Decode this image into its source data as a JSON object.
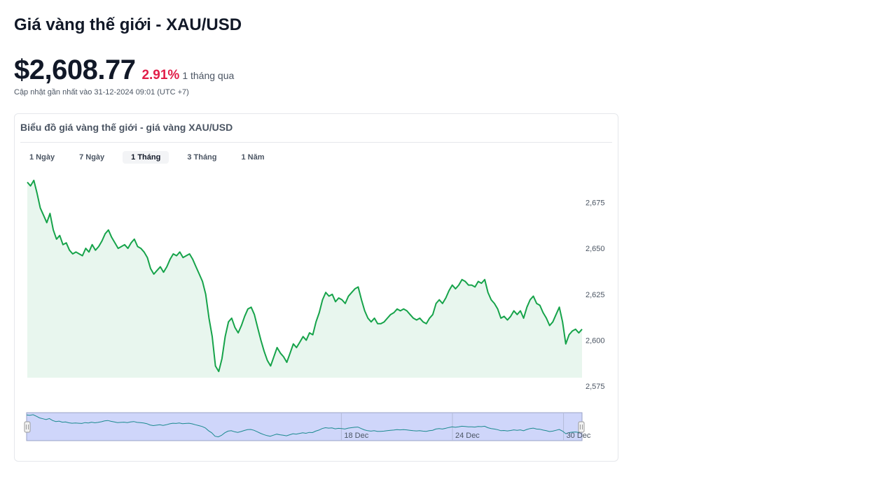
{
  "header": {
    "title": "Giá vàng thế giới - XAU/USD",
    "price": "$2,608.77",
    "change": "2.91%",
    "period": "1 tháng qua",
    "updated": "Cập nhật gần nhất vào 31-12-2024 09:01 (UTC +7)"
  },
  "card": {
    "title": "Biểu đồ giá vàng thế giới - giá vàng XAU/USD"
  },
  "range_tabs": [
    {
      "label": "1 Ngày",
      "active": false
    },
    {
      "label": "7 Ngày",
      "active": false
    },
    {
      "label": "1 Tháng",
      "active": true
    },
    {
      "label": "3 Tháng",
      "active": false
    },
    {
      "label": "1 Năm",
      "active": false
    }
  ],
  "colors": {
    "line": "#16a34a",
    "area": "#e8f6ee",
    "change_negative": "#e11d48",
    "navigator_fill": "#cfd6fa",
    "navigator_line": "#1b8a8f"
  },
  "chart_data": {
    "type": "area",
    "x_start": "2024-12-01",
    "x_end": "2024-12-31",
    "ylim": [
      2572,
      2690
    ],
    "y_ticks": [
      2575,
      2600,
      2625,
      2650,
      2675
    ],
    "y_tick_labels": [
      "2,575",
      "2,600",
      "2,625",
      "2,650",
      "2,675"
    ],
    "navigator_labels": [
      {
        "label": "18 Dec",
        "date": "2024-12-18"
      },
      {
        "label": "24 Dec",
        "date": "2024-12-24"
      },
      {
        "label": "30 Dec",
        "date": "2024-12-30"
      }
    ],
    "series": [
      {
        "name": "",
        "values": [
          2686,
          2684,
          2687,
          2680,
          2672,
          2668,
          2664,
          2669,
          2660,
          2655,
          2657,
          2652,
          2653,
          2649,
          2647,
          2648,
          2647,
          2646,
          2650,
          2648,
          2652,
          2649,
          2651,
          2654,
          2658,
          2660,
          2656,
          2653,
          2650,
          2651,
          2652,
          2650,
          2653,
          2655,
          2651,
          2650,
          2648,
          2645,
          2639,
          2636,
          2638,
          2640,
          2637,
          2640,
          2644,
          2647,
          2646,
          2648,
          2645,
          2646,
          2647,
          2644,
          2640,
          2636,
          2632,
          2625,
          2612,
          2602,
          2586,
          2583,
          2590,
          2602,
          2610,
          2612,
          2607,
          2604,
          2608,
          2613,
          2617,
          2618,
          2614,
          2607,
          2600,
          2594,
          2589,
          2586,
          2591,
          2596,
          2593,
          2591,
          2588,
          2593,
          2598,
          2596,
          2599,
          2602,
          2600,
          2604,
          2603,
          2610,
          2615,
          2622,
          2626,
          2624,
          2625,
          2621,
          2623,
          2622,
          2620,
          2624,
          2626,
          2628,
          2629,
          2622,
          2616,
          2612,
          2610,
          2612,
          2609,
          2609,
          2610,
          2612,
          2614,
          2615,
          2617,
          2616,
          2617,
          2616,
          2614,
          2612,
          2611,
          2612,
          2610,
          2609,
          2612,
          2614,
          2620,
          2622,
          2620,
          2623,
          2627,
          2630,
          2628,
          2630,
          2633,
          2632,
          2630,
          2630,
          2629,
          2632,
          2631,
          2633,
          2626,
          2622,
          2620,
          2617,
          2612,
          2613,
          2611,
          2613,
          2616,
          2614,
          2616,
          2612,
          2618,
          2622,
          2624,
          2620,
          2619,
          2615,
          2612,
          2608,
          2610,
          2614,
          2618,
          2610,
          2598,
          2603,
          2605,
          2606,
          2604,
          2606
        ]
      }
    ]
  }
}
